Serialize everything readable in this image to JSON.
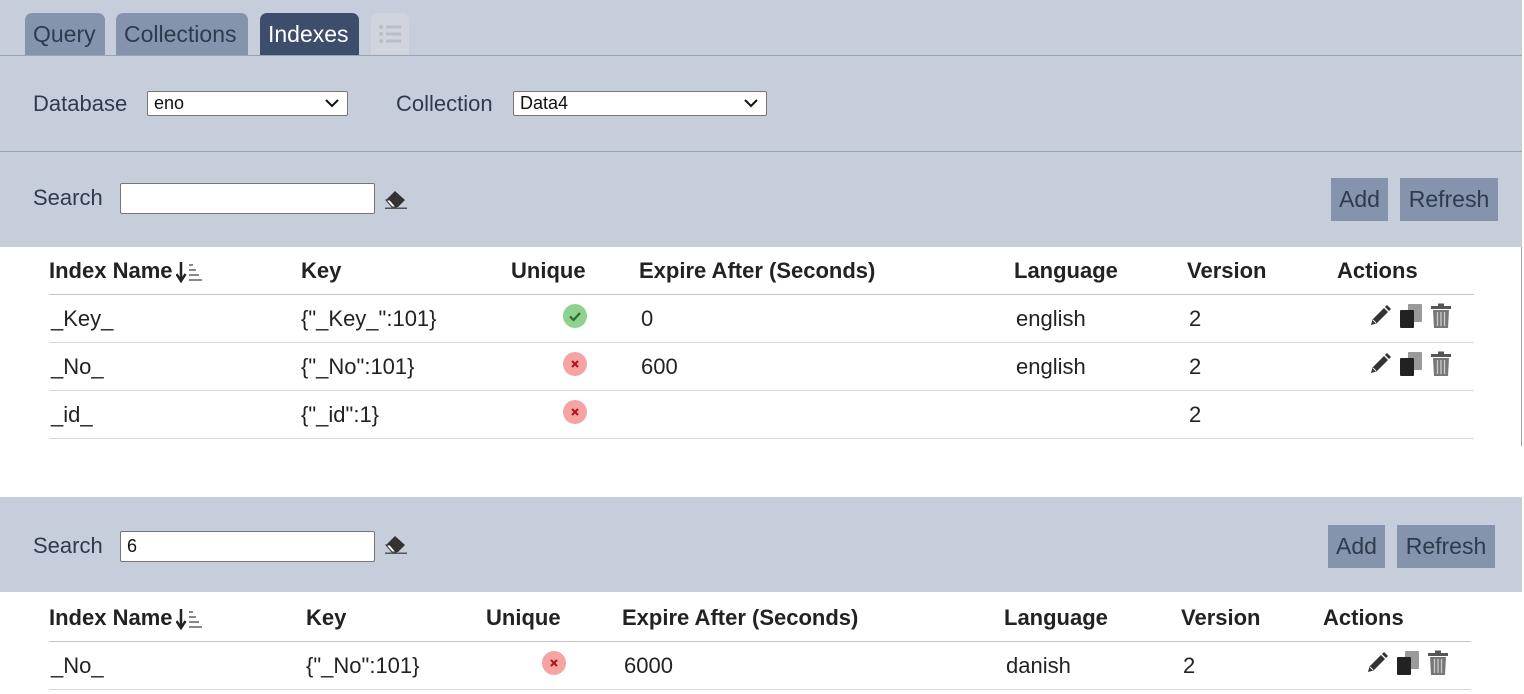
{
  "tabs": [
    {
      "label": "Query"
    },
    {
      "label": "Collections"
    },
    {
      "label": "Indexes"
    }
  ],
  "selectors": {
    "database_label": "Database",
    "database_value": "eno",
    "collection_label": "Collection",
    "collection_value": "Data4"
  },
  "columns": [
    "Index Name",
    "Key",
    "Unique",
    "Expire After (Seconds)",
    "Language",
    "Version",
    "Actions"
  ],
  "colors": {
    "unique_true": "#8fd18f",
    "unique_false": "#f5a3a3"
  },
  "views": [
    {
      "search_label": "Search",
      "search_value": "",
      "add_label": "Add",
      "refresh_label": "Refresh",
      "rows": [
        {
          "name": "_Key_",
          "key": "{\"_Key_\":101}",
          "unique": true,
          "expire": "0",
          "language": "english",
          "version": "2",
          "editable": true
        },
        {
          "name": "_No_",
          "key": "{\"_No\":101}",
          "unique": false,
          "expire": "600",
          "language": "english",
          "version": "2",
          "editable": true
        },
        {
          "name": "_id_",
          "key": "{\"_id\":1}",
          "unique": false,
          "expire": "",
          "language": "",
          "version": "2",
          "editable": false
        }
      ]
    },
    {
      "search_label": "Search",
      "search_value": "6",
      "add_label": "Add",
      "refresh_label": "Refresh",
      "rows": [
        {
          "name": "_No_",
          "key": "{\"_No\":101}",
          "unique": false,
          "expire": "6000",
          "language": "danish",
          "version": "2",
          "editable": true
        }
      ]
    }
  ]
}
